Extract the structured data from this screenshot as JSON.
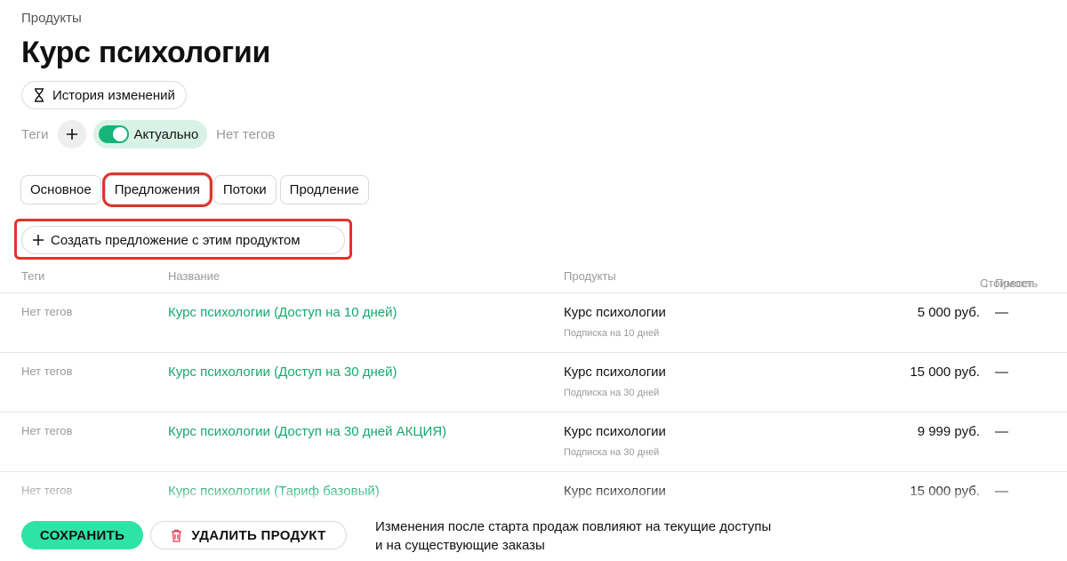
{
  "breadcrumb": "Продукты",
  "title": "Курс психологии",
  "history_button": "История изменений",
  "tags": {
    "label": "Теги",
    "toggle_label": "Актуально",
    "toggle_on": true,
    "empty_text": "Нет тегов"
  },
  "tabs": [
    {
      "label": "Основное"
    },
    {
      "label": "Предложения"
    },
    {
      "label": "Потоки"
    },
    {
      "label": "Продление"
    }
  ],
  "create_offer_button": "Создать предложение с этим продуктом",
  "table": {
    "columns": {
      "tags": "Теги",
      "name": "Название",
      "products": "Продукты",
      "cost": "Стоимость",
      "preset": "Пресет",
      "sort_arrow": "↓"
    },
    "rows": [
      {
        "tags": "Нет тегов",
        "name": "Курс психологии (Доступ на 10 дней)",
        "product": "Курс психологии",
        "subscription": "Подписка на 10 дней",
        "cost": "5 000 руб.",
        "preset": "—"
      },
      {
        "tags": "Нет тегов",
        "name": "Курс психологии (Доступ на 30 дней)",
        "product": "Курс психологии",
        "subscription": "Подписка на 30 дней",
        "cost": "15 000 руб.",
        "preset": "—"
      },
      {
        "tags": "Нет тегов",
        "name": "Курс психологии (Доступ на 30 дней АКЦИЯ)",
        "product": "Курс психологии",
        "subscription": "Подписка на 30 дней",
        "cost": "9 999 руб.",
        "preset": "—"
      },
      {
        "tags": "Нет тегов",
        "name": "Курс психологии (Тариф базовый)",
        "product": "Курс психологии",
        "subscription": "",
        "cost": "15 000 руб.",
        "preset": "—"
      }
    ]
  },
  "footer": {
    "save_label": "СОХРАНИТЬ",
    "delete_label": "УДАЛИТЬ ПРОДУКТ",
    "warning_line1": "Изменения после старта продаж повлияют на текущие доступы",
    "warning_line2": "и на существующие заказы"
  },
  "colors": {
    "accent_green": "#16a86f",
    "save_button": "#2ee3a6",
    "toggle_bg": "#d9f2e7",
    "highlight_red": "#e0332c"
  },
  "icons": {
    "history": "hourglass-icon",
    "add": "plus-icon",
    "delete": "trash-icon"
  }
}
